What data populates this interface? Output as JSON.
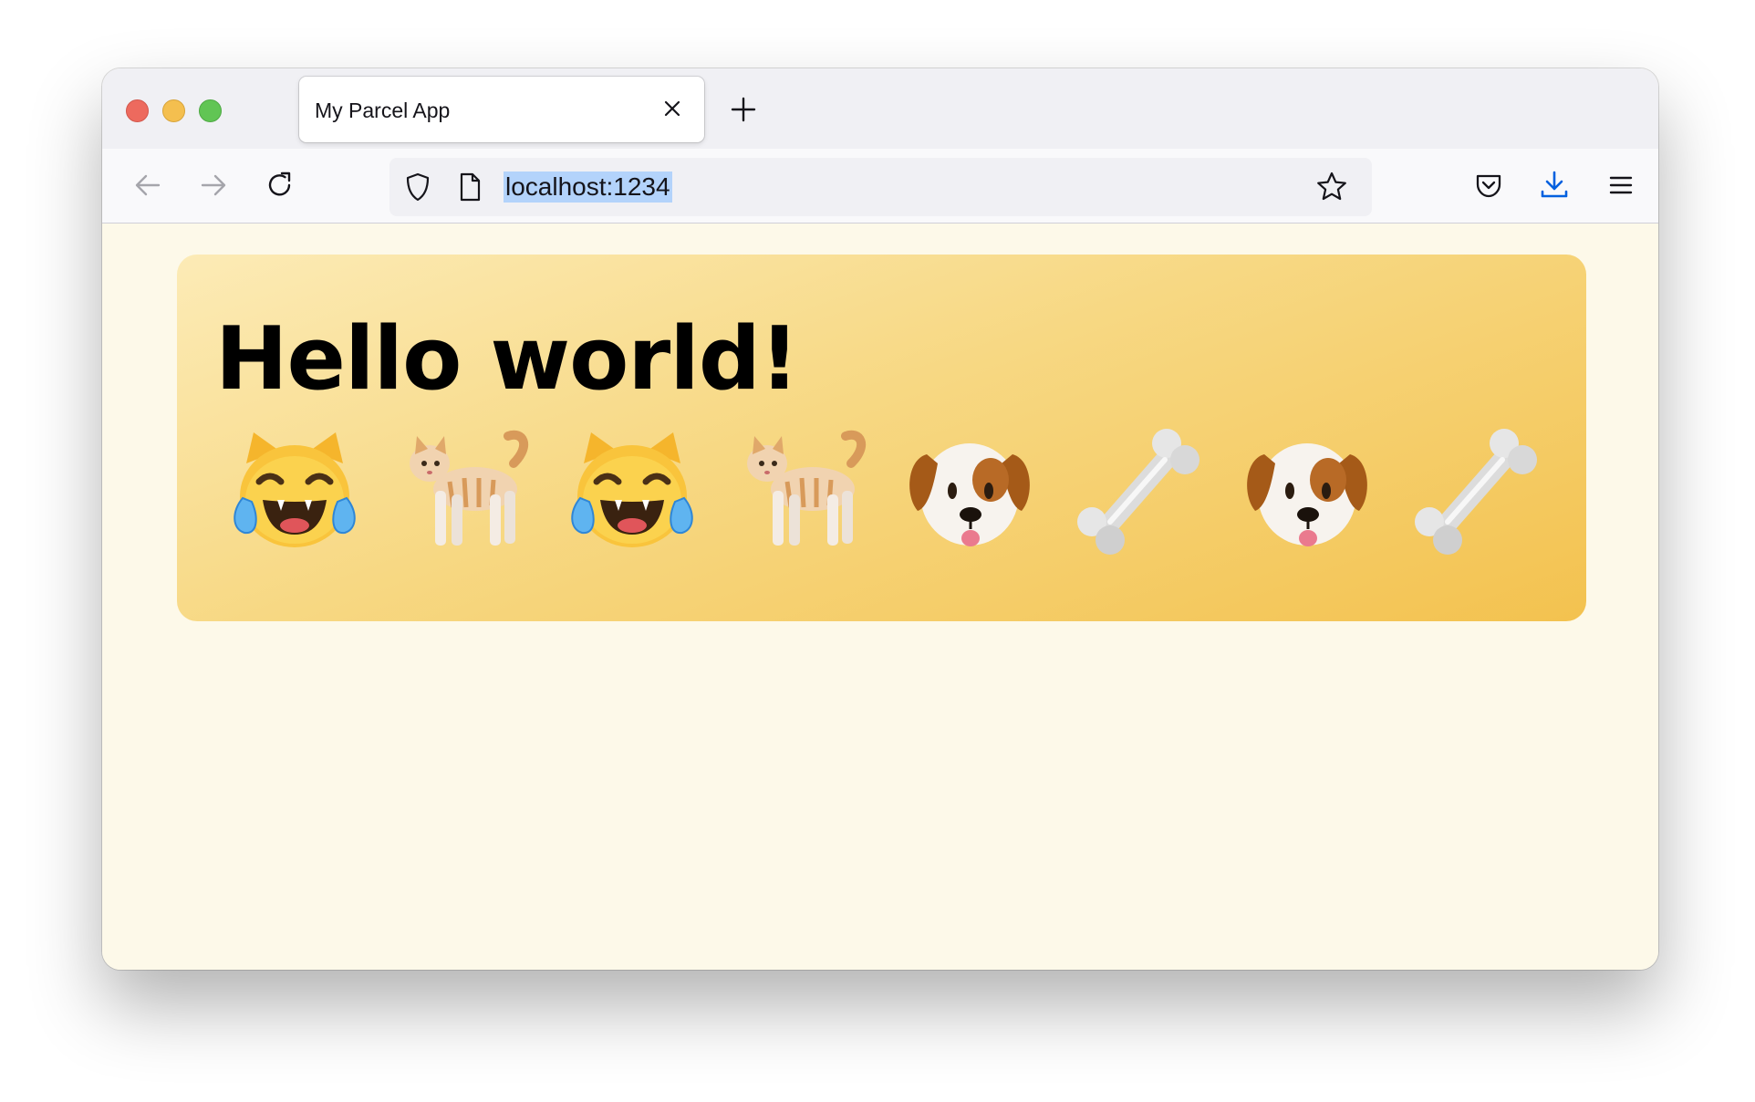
{
  "window": {
    "traffic_lights": [
      "close",
      "minimize",
      "zoom"
    ]
  },
  "tab": {
    "title": "My Parcel App",
    "close_icon": "close-icon"
  },
  "toolbar": {
    "back_icon": "back-arrow-icon",
    "forward_icon": "forward-arrow-icon",
    "reload_icon": "reload-icon",
    "url": "localhost:1234",
    "shield_icon": "tracking-protection-shield-icon",
    "page_icon": "page-icon",
    "bookmark_icon": "star-icon",
    "pocket_icon": "pocket-icon",
    "download_icon": "download-icon",
    "menu_icon": "hamburger-menu-icon"
  },
  "page": {
    "heading": "Hello world!",
    "emojis": [
      "cat-tears-of-joy",
      "cat",
      "cat-tears-of-joy",
      "cat",
      "dog-face",
      "bone",
      "dog-face",
      "bone"
    ]
  },
  "colors": {
    "background": "#fdf9e9",
    "card_gradient_start": "#fcebb6",
    "card_gradient_end": "#f3c24f",
    "url_selection": "#b3d3fb",
    "download_accent": "#0060df"
  }
}
